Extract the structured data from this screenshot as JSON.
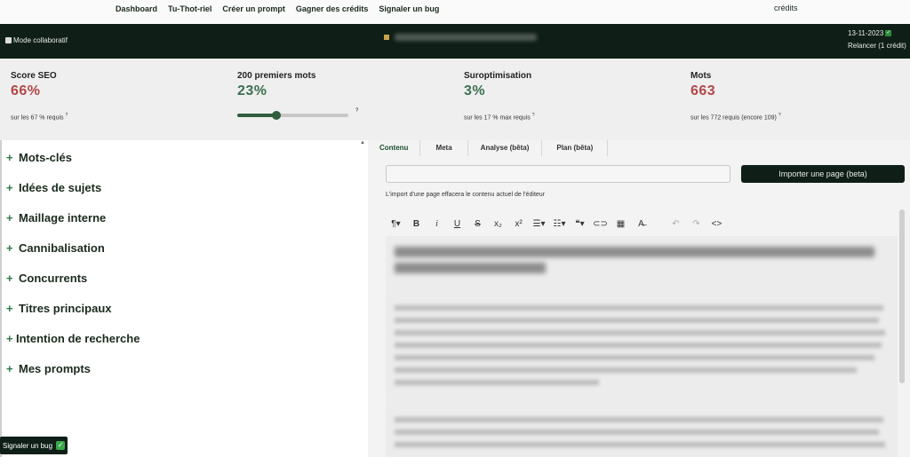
{
  "topnav": {
    "links": [
      "Dashboard",
      "Tu-Thot-riel",
      "Créer un prompt",
      "Gagner des crédits",
      "Signaler un bug"
    ],
    "credits": "crédits"
  },
  "darkbar": {
    "collab_label": "Mode collaboratif",
    "date": "13-11-2023",
    "relancer": "Relancer (1 crédit)"
  },
  "stats": {
    "seo": {
      "label": "Score SEO",
      "value": "66%",
      "sub": "sur les 67 % requis",
      "color": "#b24648"
    },
    "first_words": {
      "label": "200 premiers mots",
      "value": "23%",
      "slider_fraction": 0.35,
      "color": "#3c7050"
    },
    "overopt": {
      "label": "Suroptimisation",
      "value": "3%",
      "sub": "sur les 17 % max requis",
      "color": "#3c7050"
    },
    "words": {
      "label": "Mots",
      "value": "663",
      "sub": "sur les 772 requis (encore 109)",
      "color": "#b24648"
    }
  },
  "accordion": [
    "Mots-clés",
    "Idées de sujets",
    "Maillage interne",
    "Cannibalisation",
    "Concurrents",
    "Titres principaux",
    "Intention de recherche",
    "Mes prompts"
  ],
  "bug_button": "Signaler un bug",
  "tabs": [
    "Contenu",
    "Meta",
    "Analyse (bêta)",
    "Plan (bêta)"
  ],
  "import": {
    "button": "Importer une page (beta)",
    "hint": "L'import d'une page effacera le contenu actuel de l'éditeur"
  },
  "toolbar_icons": [
    "paragraph-icon",
    "bold-icon",
    "italic-icon",
    "underline-icon",
    "strikethrough-icon",
    "subscript-icon",
    "superscript-icon",
    "ordered-list-icon",
    "bullet-list-icon",
    "quote-icon",
    "link-icon",
    "table-icon",
    "clear-format-icon",
    "undo-icon",
    "redo-icon",
    "code-icon"
  ]
}
